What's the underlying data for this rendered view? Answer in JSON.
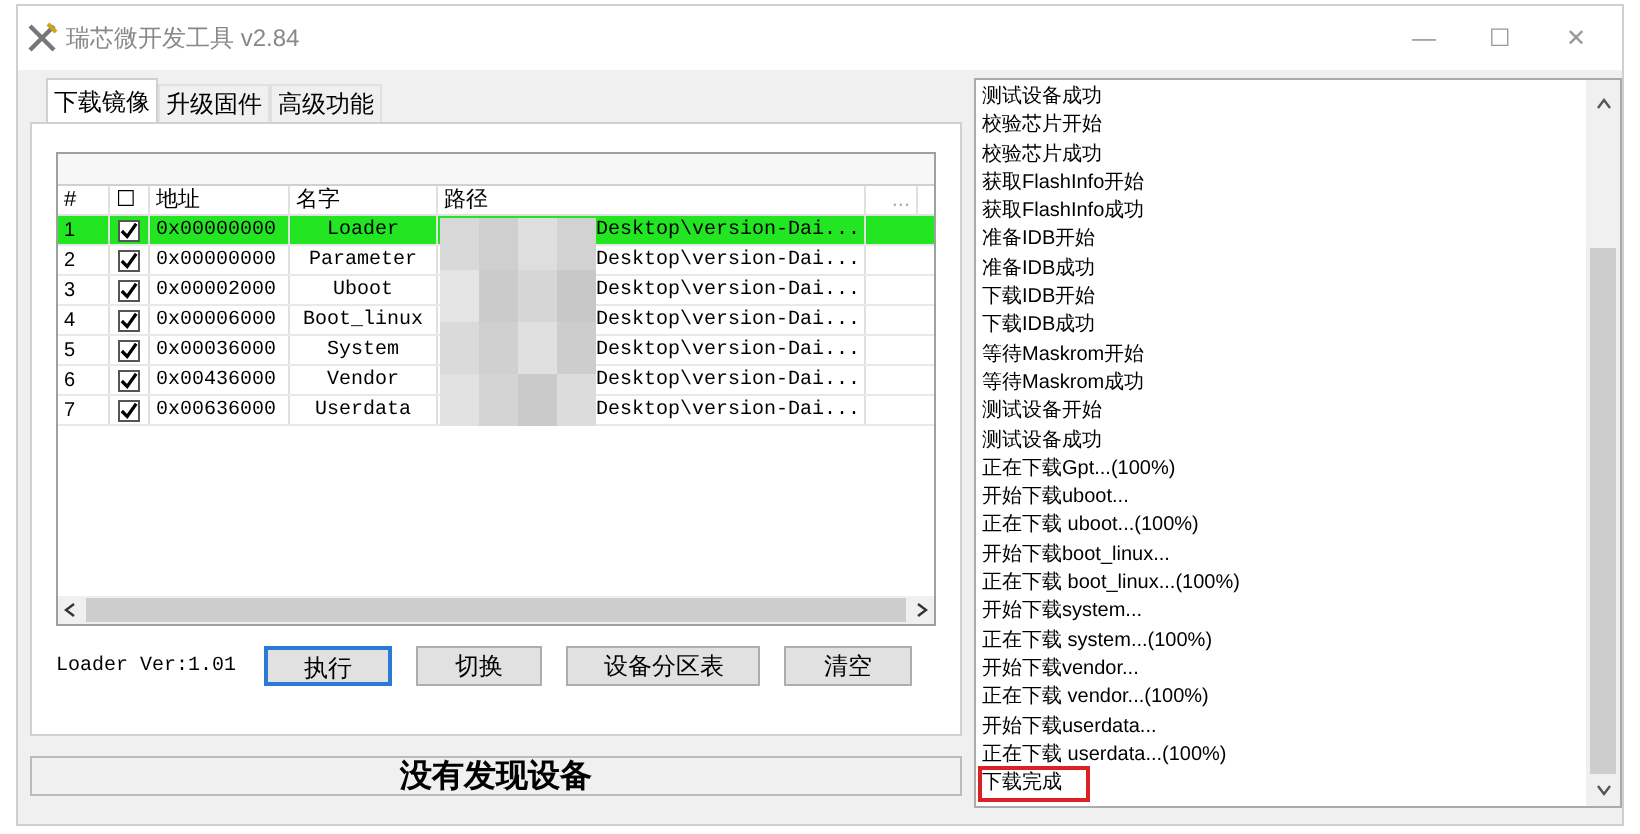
{
  "window": {
    "title": "瑞芯微开发工具 v2.84",
    "controls": [
      "—",
      "☐",
      "✕"
    ]
  },
  "tabs": [
    {
      "label": "下载镜像",
      "selected": true
    },
    {
      "label": "升级固件",
      "selected": false
    },
    {
      "label": "高级功能",
      "selected": false
    }
  ],
  "table": {
    "columns": [
      "#",
      "☐",
      "地址",
      "名字",
      "路径",
      "..."
    ],
    "rows": [
      {
        "index": "1",
        "checked": true,
        "address": "0x00000000",
        "name": "Loader",
        "path": "Desktop\\version-Dai...",
        "selected": true
      },
      {
        "index": "2",
        "checked": true,
        "address": "0x00000000",
        "name": "Parameter",
        "path": "Desktop\\version-Dai...",
        "selected": false
      },
      {
        "index": "3",
        "checked": true,
        "address": "0x00002000",
        "name": "Uboot",
        "path": "Desktop\\version-Dai...",
        "selected": false
      },
      {
        "index": "4",
        "checked": true,
        "address": "0x00006000",
        "name": "Boot_linux",
        "path": "Desktop\\version-Dai...",
        "selected": false
      },
      {
        "index": "5",
        "checked": true,
        "address": "0x00036000",
        "name": "System",
        "path": "Desktop\\version-Dai...",
        "selected": false
      },
      {
        "index": "6",
        "checked": true,
        "address": "0x00436000",
        "name": "Vendor",
        "path": "Desktop\\version-Dai...",
        "selected": false
      },
      {
        "index": "7",
        "checked": true,
        "address": "0x00636000",
        "name": "Userdata",
        "path": "Desktop\\version-Dai...",
        "selected": false
      }
    ]
  },
  "loader_version": "Loader Ver:1.01",
  "buttons": [
    {
      "label": "执行",
      "focused": true
    },
    {
      "label": "切换",
      "focused": false
    },
    {
      "label": "设备分区表",
      "focused": false
    },
    {
      "label": "清空",
      "focused": false
    }
  ],
  "status": "没有发现设备",
  "log": [
    {
      "text": "测试设备成功",
      "highlighted": false
    },
    {
      "text": "校验芯片开始",
      "highlighted": false
    },
    {
      "text": "校验芯片成功",
      "highlighted": false
    },
    {
      "text": "获取FlashInfo开始",
      "highlighted": false
    },
    {
      "text": "获取FlashInfo成功",
      "highlighted": false
    },
    {
      "text": "准备IDB开始",
      "highlighted": false
    },
    {
      "text": "准备IDB成功",
      "highlighted": false
    },
    {
      "text": "下载IDB开始",
      "highlighted": false
    },
    {
      "text": "下载IDB成功",
      "highlighted": false
    },
    {
      "text": "等待Maskrom开始",
      "highlighted": false
    },
    {
      "text": "等待Maskrom成功",
      "highlighted": false
    },
    {
      "text": "测试设备开始",
      "highlighted": false
    },
    {
      "text": "测试设备成功",
      "highlighted": false
    },
    {
      "text": "正在下载Gpt...(100%)",
      "highlighted": false
    },
    {
      "text": "开始下载uboot...",
      "highlighted": false
    },
    {
      "text": "正在下载 uboot...(100%)",
      "highlighted": false
    },
    {
      "text": "开始下载boot_linux...",
      "highlighted": false
    },
    {
      "text": "正在下载 boot_linux...(100%)",
      "highlighted": false
    },
    {
      "text": "开始下载system...",
      "highlighted": false
    },
    {
      "text": "正在下载 system...(100%)",
      "highlighted": false
    },
    {
      "text": "开始下载vendor...",
      "highlighted": false
    },
    {
      "text": "正在下载 vendor...(100%)",
      "highlighted": false
    },
    {
      "text": "开始下载userdata...",
      "highlighted": false
    },
    {
      "text": "正在下载 userdata...(100%)",
      "highlighted": false
    },
    {
      "text": "下载完成",
      "highlighted": true
    }
  ]
}
